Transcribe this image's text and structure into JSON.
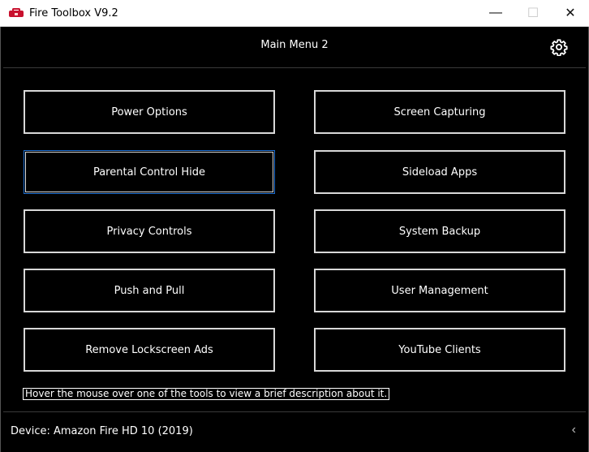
{
  "window": {
    "title": "Fire Toolbox V9.2",
    "minimize_glyph": "—",
    "maximize_glyph": "☐",
    "close_glyph": "✕"
  },
  "header": {
    "title": "Main Menu 2",
    "settings_icon": "gear-icon"
  },
  "tools": {
    "left": [
      {
        "label": "Power Options"
      },
      {
        "label": "Parental Control Hide"
      },
      {
        "label": "Privacy Controls"
      },
      {
        "label": "Push and Pull"
      },
      {
        "label": "Remove Lockscreen Ads"
      }
    ],
    "right": [
      {
        "label": "Screen Capturing"
      },
      {
        "label": "Sideload Apps"
      },
      {
        "label": "System Backup"
      },
      {
        "label": "User Management"
      },
      {
        "label": "YouTube Clients"
      }
    ]
  },
  "description": "Hover the mouse over one of the tools to view a brief description about it.",
  "footer": {
    "device": "Device: Amazon Fire HD 10 (2019)",
    "back_glyph": "‹"
  },
  "colors": {
    "background": "#000000",
    "button_border": "#d8d8d8",
    "focus_border": "#1f6fd1",
    "icon_red": "#c8102e"
  }
}
